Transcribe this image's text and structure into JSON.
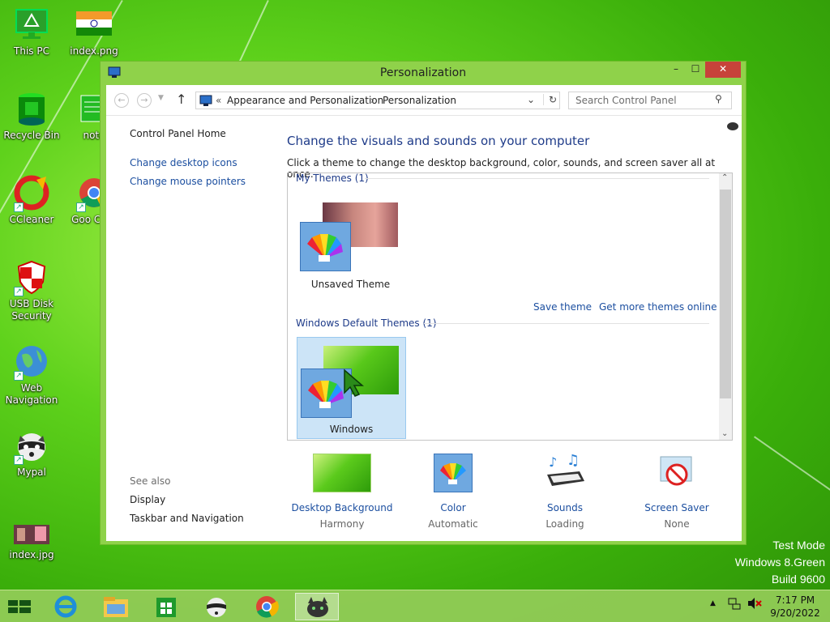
{
  "desktop": {
    "icons": [
      {
        "label": "This PC"
      },
      {
        "label": "index.png"
      },
      {
        "label": "Recycle Bin"
      },
      {
        "label": "note"
      },
      {
        "label": "CCleaner"
      },
      {
        "label": "Goo Chro"
      },
      {
        "label": "USB Disk Security"
      },
      {
        "label": "Web Navigation"
      },
      {
        "label": "Mypal"
      },
      {
        "label": "index.jpg"
      }
    ],
    "watermark": {
      "line1": "Test Mode",
      "line2": "Windows 8.Green",
      "line3": "Build 9600"
    }
  },
  "window": {
    "title": "Personalization",
    "controls": {
      "minimize": "–",
      "maximize": "☐",
      "close": "✕"
    },
    "breadcrumb": {
      "sep": "«",
      "part1": "Appearance and Personalization",
      "arrow": "›",
      "part2": "Personalization"
    },
    "search_placeholder": "Search Control Panel",
    "sidebar": {
      "home": "Control Panel Home",
      "links": [
        "Change desktop icons",
        "Change mouse pointers"
      ],
      "see_also": "See also",
      "see_also_links": [
        "Display",
        "Taskbar and Navigation"
      ]
    },
    "main": {
      "heading": "Change the visuals and sounds on your computer",
      "subtext": "Click a theme to change the desktop background, color, sounds, and screen saver all at once.",
      "my_themes_group": "My Themes (1)",
      "unsaved_theme": "Unsaved Theme",
      "save_theme": "Save theme",
      "get_more": "Get more themes online",
      "default_group": "Windows Default Themes (1)",
      "windows_theme": "Windows"
    },
    "bottom": [
      {
        "label": "Desktop Background",
        "value": "Harmony"
      },
      {
        "label": "Color",
        "value": "Automatic"
      },
      {
        "label": "Sounds",
        "value": "Loading"
      },
      {
        "label": "Screen Saver",
        "value": "None"
      }
    ]
  },
  "taskbar": {
    "time": "7:17 PM",
    "date": "9/20/2022"
  }
}
